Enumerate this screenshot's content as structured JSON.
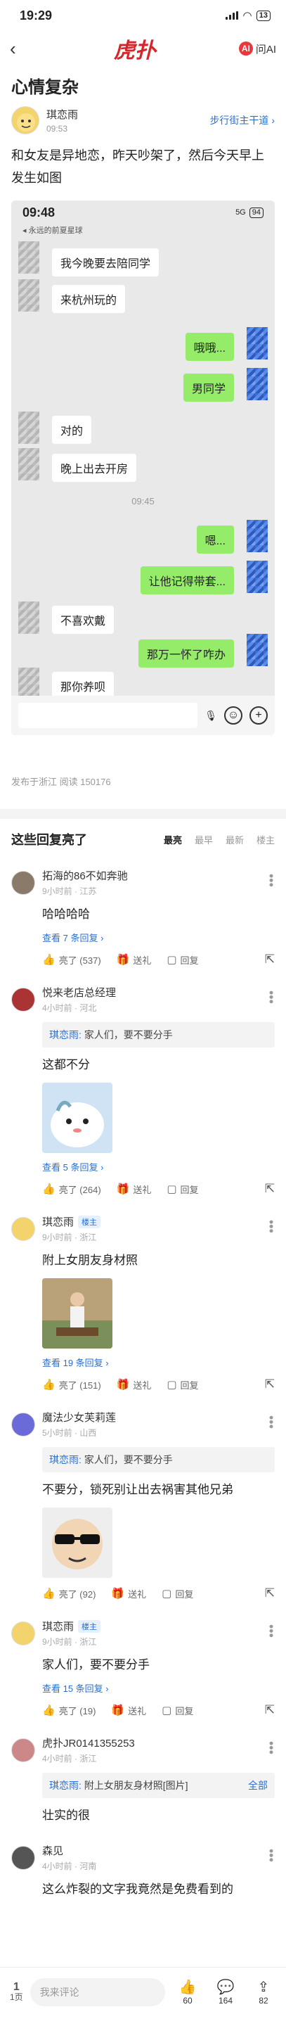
{
  "status_bar": {
    "time": "19:29",
    "battery": "13"
  },
  "nav": {
    "logo": "虎扑",
    "ai_label": "问AI",
    "ai_icon_text": "AI"
  },
  "post": {
    "title": "心情复杂",
    "author": "琪恋雨",
    "time": "09:53",
    "board": "步行街主干道 ›",
    "body": "和女友是异地恋，昨天吵架了，然后今天早上发生如图",
    "meta": "发布于浙江   阅读 150176"
  },
  "screenshot": {
    "time": "09:48",
    "network": "5G",
    "battery": "94",
    "subtitle": "◂ 永远的前夏星球",
    "messages": [
      {
        "side": "left",
        "text": "我今晚要去陪同学"
      },
      {
        "side": "left",
        "text": "来杭州玩的"
      },
      {
        "side": "right",
        "text": "哦哦..."
      },
      {
        "side": "right",
        "text": "男同学"
      },
      {
        "side": "left",
        "text": "对的"
      },
      {
        "side": "left",
        "text": "晚上出去开房"
      },
      {
        "side": "right",
        "text": "嗯..."
      },
      {
        "side": "right",
        "text": "让他记得带套..."
      },
      {
        "side": "left",
        "text": "不喜欢戴"
      },
      {
        "side": "right",
        "text": "那万一怀了咋办"
      },
      {
        "side": "left",
        "text": "那你养呗"
      }
    ],
    "divider_time": "09:45"
  },
  "replies": {
    "title": "这些回复亮了",
    "sort": [
      "最亮",
      "最早",
      "最新",
      "楼主"
    ],
    "items": [
      {
        "name": "拓海的86不如奔驰",
        "time": "9小时前 · 江苏",
        "text": "哈哈哈哈",
        "view_more": "查看 7 条回复 ›",
        "likes": "亮了 (537)",
        "gift": "送礼",
        "reply": "回复"
      },
      {
        "name": "悦来老店总经理",
        "time": "4小时前 · 河北",
        "quote_name": "琪恋雨:",
        "quote_text": "家人们，要不要分手",
        "text": "这都不分",
        "view_more": "查看 5 条回复 ›",
        "likes": "亮了 (264)",
        "gift": "送礼",
        "reply": "回复"
      },
      {
        "name": "琪恋雨",
        "badge": "楼主",
        "time": "9小时前 · 浙江",
        "text": "附上女朋友身材照",
        "view_more": "查看 19 条回复 ›",
        "likes": "亮了 (151)",
        "gift": "送礼",
        "reply": "回复"
      },
      {
        "name": "魔法少女芙莉莲",
        "time": "5小时前 · 山西",
        "quote_name": "琪恋雨:",
        "quote_text": "家人们，要不要分手",
        "text": "不要分，锁死别让出去祸害其他兄弟",
        "likes": "亮了 (92)",
        "gift": "送礼",
        "reply": "回复"
      },
      {
        "name": "琪恋雨",
        "badge": "楼主",
        "time": "9小时前 · 浙江",
        "text": "家人们，要不要分手",
        "view_more": "查看 15 条回复 ›",
        "likes": "亮了 (19)",
        "gift": "送礼",
        "reply": "回复"
      },
      {
        "name": "虎扑JR0141355253",
        "time": "4小时前 · 浙江",
        "quote_name": "琪恋雨:",
        "quote_text": "附上女朋友身材照[图片]",
        "quote_all": "全部",
        "text": "壮实的很"
      },
      {
        "name": "森见",
        "time": "4小时前 · 河南",
        "text": "这么炸裂的文字我竟然是免费看到的"
      }
    ]
  },
  "bottom_bar": {
    "page": "1",
    "page_label": "1页",
    "comment_placeholder": "我来评论",
    "likes": "60",
    "comments": "164",
    "shares": "82"
  },
  "colors": {
    "brand": "#d4262b",
    "link": "#2b6fd0",
    "bubble_right": "#95ec69"
  }
}
